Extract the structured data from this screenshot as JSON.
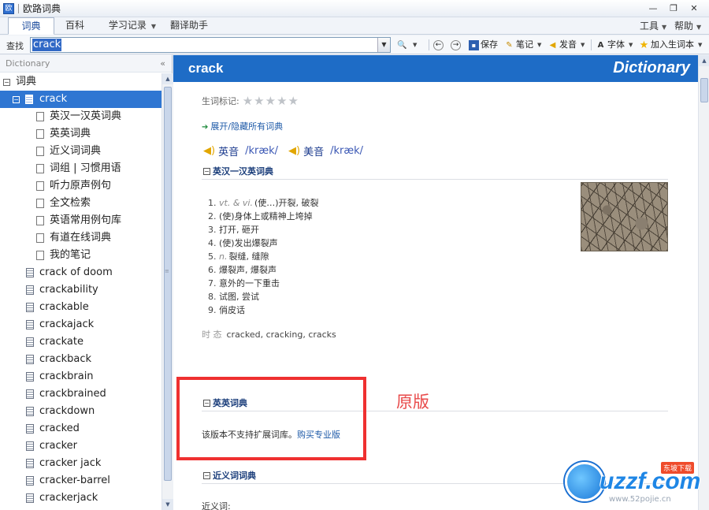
{
  "window": {
    "title": "欧路词典",
    "controls": [
      "—",
      "❐",
      "✕"
    ]
  },
  "tabs": [
    {
      "label": "词典",
      "active": true
    },
    {
      "label": "百科",
      "active": false
    },
    {
      "label": "学习记录",
      "active": false,
      "dropdown": true
    },
    {
      "label": "翻译助手",
      "active": false
    }
  ],
  "menu": {
    "tools": "工具",
    "help": "帮助"
  },
  "toolbar": {
    "search_label": "查找",
    "search_value": "crack",
    "save": "保存",
    "note": "笔记",
    "pronounce": "发音",
    "font": "字体",
    "add_word": "加入生词本"
  },
  "sidebar": {
    "header": "Dictionary",
    "collapse_glyph": "«",
    "root": "词典",
    "selected": "crack",
    "dict_children": [
      "英汉一汉英词典",
      "英英词典",
      "近义词词典",
      "词组 | 习惯用语",
      "听力原声例句",
      "全文检索",
      "英语常用例句库",
      "有道在线词典",
      "我的笔记"
    ],
    "words": [
      "crack of doom",
      "crackability",
      "crackable",
      "crackajack",
      "crackate",
      "crackback",
      "crackbrain",
      "crackbrained",
      "crackdown",
      "cracked",
      "cracker",
      "cracker jack",
      "cracker-barrel",
      "crackerjack"
    ]
  },
  "entry": {
    "word": "crack",
    "brand": "Dictionary",
    "rating_label": "生词标记:",
    "rating": 0,
    "rating_max": 5,
    "expand_all": "展开/隐藏所有词典",
    "pron_uk_label": "英音",
    "pron_uk": "/kræk/",
    "pron_us_label": "美音",
    "pron_us": "/kræk/",
    "section_ec": "英汉一汉英词典",
    "definitions": [
      {
        "num": "1.",
        "pos": "vt. & vi.",
        "text": "(使…)开裂, 破裂"
      },
      {
        "num": "2.",
        "pos": "",
        "text": "(使)身体上或精神上垮掉"
      },
      {
        "num": "3.",
        "pos": "",
        "text": "打开, 砸开"
      },
      {
        "num": "4.",
        "pos": "",
        "text": "(使)发出爆裂声"
      },
      {
        "num": "5.",
        "pos": "n.",
        "text": "裂缝, 缝隙"
      },
      {
        "num": "6.",
        "pos": "",
        "text": "爆裂声, 爆裂声"
      },
      {
        "num": "7.",
        "pos": "",
        "text": "意外的一下重击"
      },
      {
        "num": "8.",
        "pos": "",
        "text": "试图, 尝试"
      },
      {
        "num": "9.",
        "pos": "",
        "text": "俏皮话"
      }
    ],
    "forms_label": "时 态",
    "forms": "cracked, cracking, cracks",
    "section_ee": "英英词典",
    "promo_text": "该版本不支持扩展词库。",
    "promo_link": "购买专业版",
    "section_syn": "近义词词典",
    "synonym_label": "近义词:"
  },
  "annotation": {
    "label": "原版",
    "color": "#ef3030"
  },
  "watermark": {
    "brand": "uzzf.com",
    "tag": "东坡下载",
    "url": "www.52pojie.cn"
  }
}
